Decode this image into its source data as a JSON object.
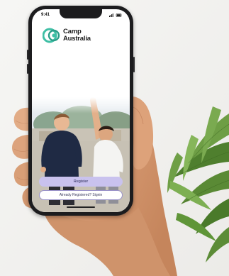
{
  "scene": {
    "description_icons": [
      "camp-australia-logo-icon",
      "signal-icon",
      "battery-icon"
    ]
  },
  "app": {
    "brand_line1": "Camp",
    "brand_line2": "Australia",
    "status_time": "9:41",
    "primary_button_label": "Register",
    "secondary_button_label": "Already Registered? Signin"
  },
  "colors": {
    "brand_teal": "#3fbfa5",
    "button_lavender": "#c9c2ee",
    "button_outline": "#9b93c9",
    "phone_body": "#1c1c1e"
  }
}
